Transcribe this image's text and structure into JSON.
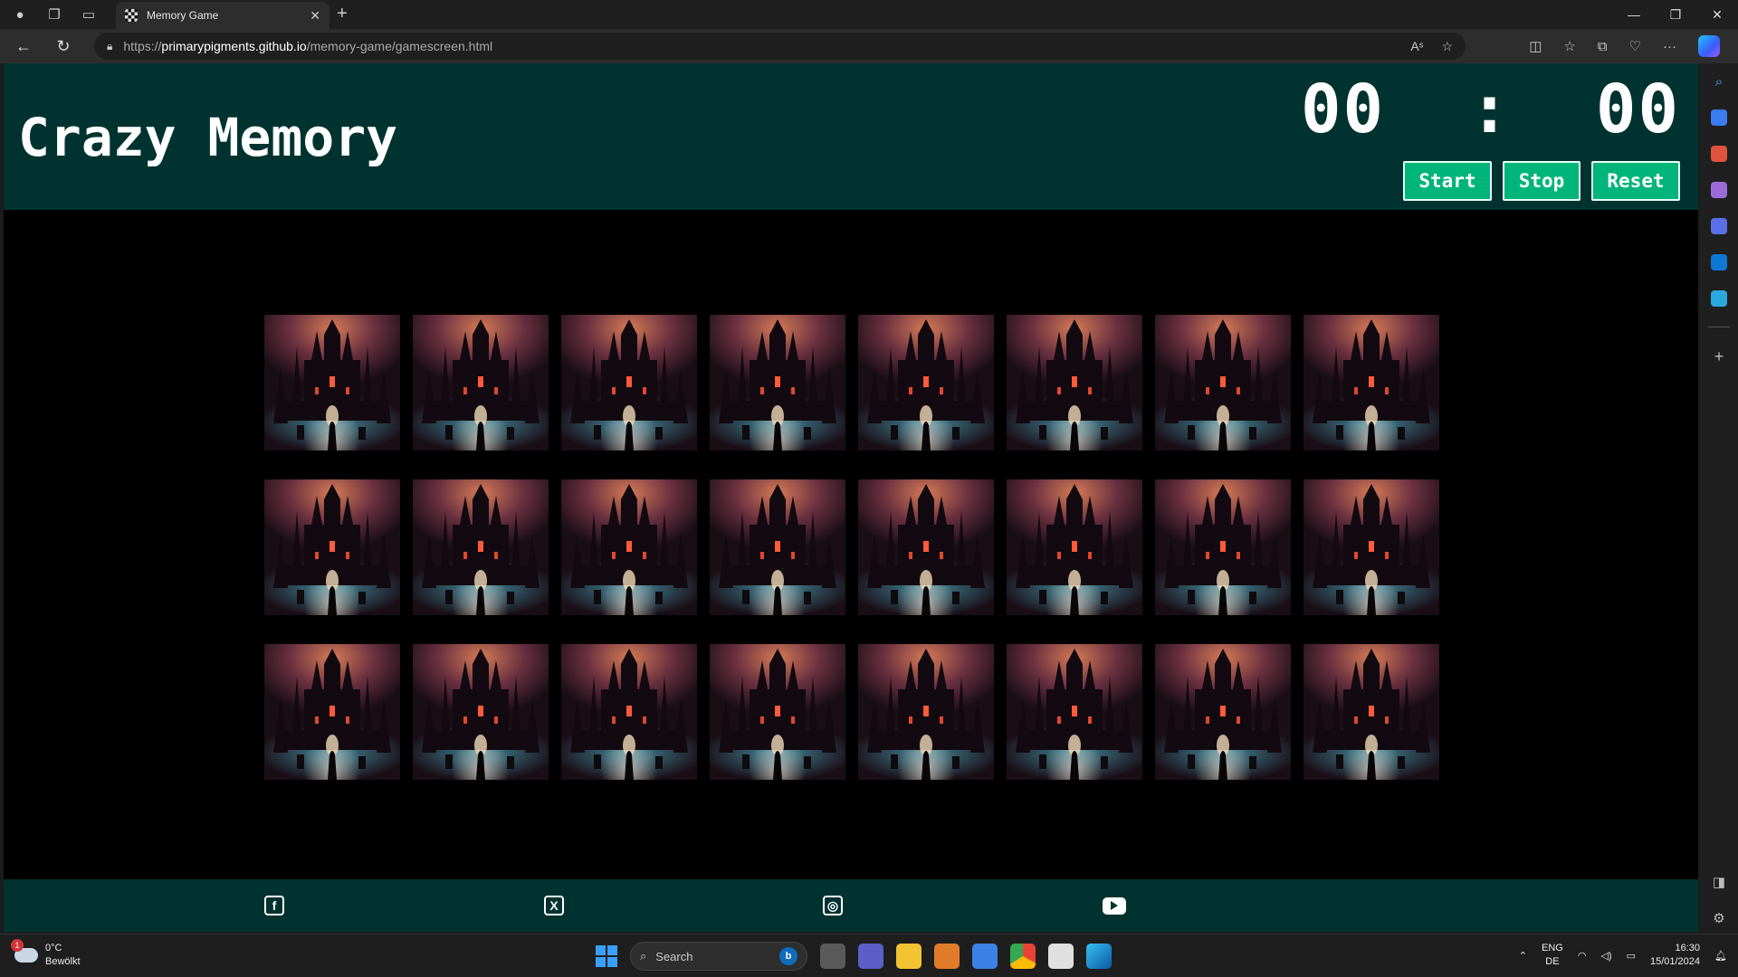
{
  "browser": {
    "tab_title": "Memory Game",
    "url_scheme": "https://",
    "url_host": "primarypigments.github.io",
    "url_path": "/memory-game/gamescreen.html"
  },
  "game": {
    "title": "Crazy Memory",
    "timer": {
      "minutes": "00",
      "separator": ":",
      "seconds": "00"
    },
    "buttons": {
      "start": "Start",
      "stop": "Stop",
      "reset": "Reset"
    },
    "card_count": 24,
    "columns": 8,
    "rows": 3
  },
  "footer": {
    "social": [
      "facebook-icon",
      "x-twitter-icon",
      "instagram-icon",
      "youtube-icon"
    ]
  },
  "taskbar": {
    "weather_temp": "0°C",
    "weather_desc": "Bewölkt",
    "weather_badge": "1",
    "search_placeholder": "Search",
    "lang_top": "ENG",
    "lang_bottom": "DE",
    "time": "16:30",
    "date": "15/01/2024"
  }
}
